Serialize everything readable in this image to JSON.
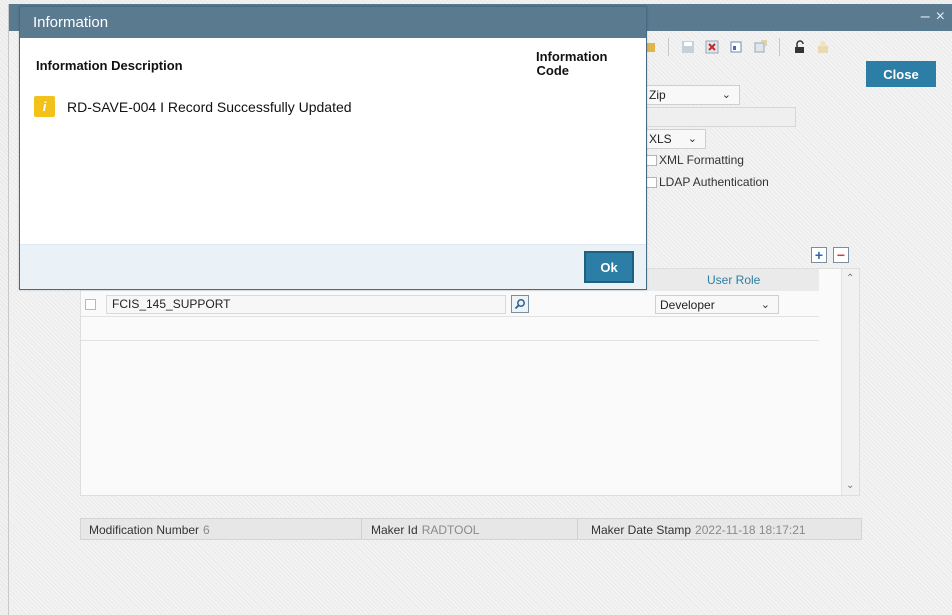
{
  "modal": {
    "title": "Information",
    "col_description": "Information Description",
    "col_code_line1": "Information",
    "col_code_line2": "Code",
    "message": "RD-SAVE-004 I Record Successfully Updated",
    "ok_label": "Ok"
  },
  "window": {
    "minimize_glyph": "–",
    "close_glyph": "×",
    "close_button_label": "Close"
  },
  "form": {
    "zip_select_value": "Zip",
    "format_select_value": "XLS",
    "xml_formatting_label": "XML Formatting",
    "ldap_auth_label": "LDAP Authentication"
  },
  "grid": {
    "user_role_header": "User Role",
    "rows": [
      {
        "user_id": "FCIS_145_SUPPORT",
        "role": "Developer"
      }
    ]
  },
  "footer": {
    "modification_label": "Modification Number",
    "modification_value": "6",
    "maker_id_label": "Maker Id",
    "maker_id_value": "RADTOOL",
    "maker_date_label": "Maker Date Stamp",
    "maker_date_value": "2022-11-18 18:17:21"
  },
  "icons": {
    "info": "info-icon",
    "search": "search-icon",
    "add_row": "plus-icon",
    "delete_row": "minus-icon"
  },
  "colors": {
    "titlebar": "#5a7a90",
    "primary_button": "#2c7ea6",
    "info_icon": "#f2c21b"
  }
}
